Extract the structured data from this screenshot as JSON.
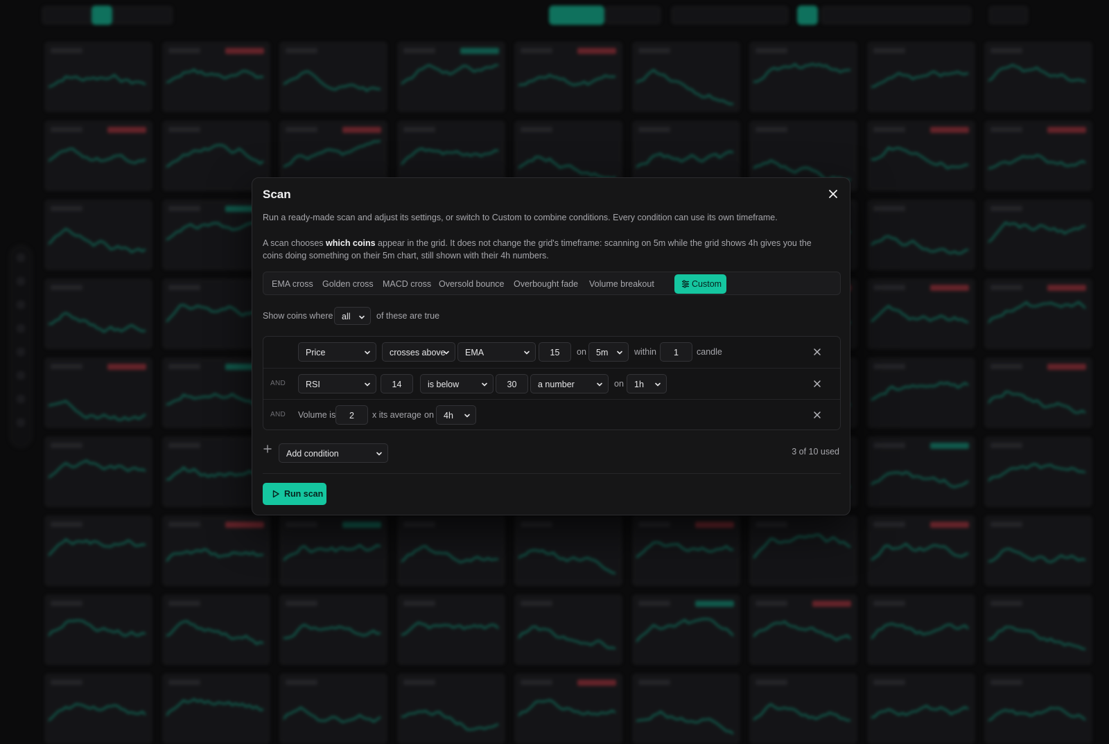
{
  "colors": {
    "accent": "#15c6a0",
    "danger": "#e0434f",
    "surface": "#161617"
  },
  "modal": {
    "title": "Scan",
    "description": "Run a ready-made scan and adjust its settings, or switch to Custom to combine conditions. Every condition can use its own timeframe.",
    "note_before": "A scan chooses ",
    "note_bold": "which coins",
    "note_after": " appear in the grid. It does not change the grid's timeframe: scanning on 5m while the grid shows 4h gives you the coins doing something on their 5m chart, still shown with their 4h numbers.",
    "presets": [
      "EMA cross",
      "Golden cross",
      "MACD cross",
      "Oversold bounce",
      "Overbought fade",
      "Volume breakout",
      "Custom"
    ],
    "show_prefix": "Show coins where",
    "show_mode": "all",
    "show_suffix": "of these are true",
    "conditions": [
      {
        "joiner": "",
        "source": "Price",
        "operator": "crosses above",
        "target": "EMA",
        "period": "15",
        "on_label": "on",
        "timeframe": "5m",
        "within_label": "within",
        "within": "1",
        "unit": "candle"
      },
      {
        "joiner": "AND",
        "source": "RSI",
        "period": "14",
        "operator": "is below",
        "value": "30",
        "compare": "a number",
        "on_label": "on",
        "timeframe": "1h"
      },
      {
        "joiner": "AND",
        "prefix": "Volume is",
        "value": "2",
        "suffix": "x its average",
        "on_label": "on",
        "timeframe": "4h"
      }
    ],
    "add_condition": "Add condition",
    "used": "3 of 10 used",
    "run_label": "Run scan"
  }
}
